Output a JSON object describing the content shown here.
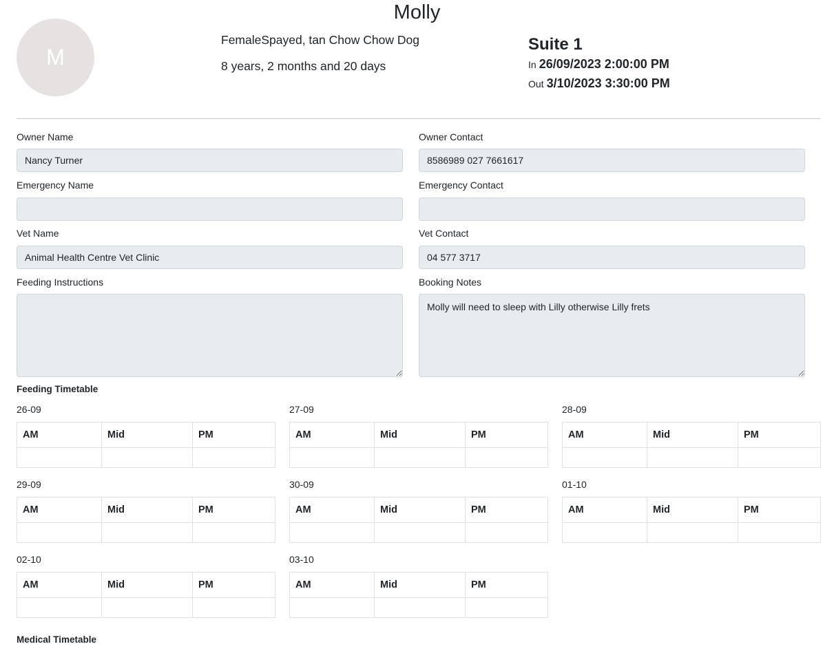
{
  "pet": {
    "name": "Molly",
    "initial": "M",
    "description": "FemaleSpayed, tan Chow Chow Dog",
    "age": "8 years, 2 months and 20 days"
  },
  "booking": {
    "suite": "Suite 1",
    "in_label": "In",
    "in_value": "26/09/2023 2:00:00 PM",
    "out_label": "Out",
    "out_value": "3/10/2023 3:30:00 PM"
  },
  "fields": {
    "owner_name_label": "Owner Name",
    "owner_name": "Nancy Turner",
    "owner_contact_label": "Owner Contact",
    "owner_contact": "8586989 027 7661617",
    "emergency_name_label": "Emergency Name",
    "emergency_name": "",
    "emergency_contact_label": "Emergency Contact",
    "emergency_contact": "",
    "vet_name_label": "Vet Name",
    "vet_name": "Animal Health Centre Vet Clinic",
    "vet_contact_label": "Vet Contact",
    "vet_contact": "04 577 3717",
    "feeding_instructions_label": "Feeding Instructions",
    "feeding_instructions": "",
    "booking_notes_label": "Booking Notes",
    "booking_notes": "Molly will need to sleep with Lilly otherwise Lilly frets"
  },
  "feeding": {
    "title": "Feeding Timetable",
    "columns": [
      "AM",
      "Mid",
      "PM"
    ],
    "days": [
      "26-09",
      "27-09",
      "28-09",
      "29-09",
      "30-09",
      "01-10",
      "02-10",
      "03-10"
    ]
  },
  "medical": {
    "title": "Medical Timetable"
  }
}
